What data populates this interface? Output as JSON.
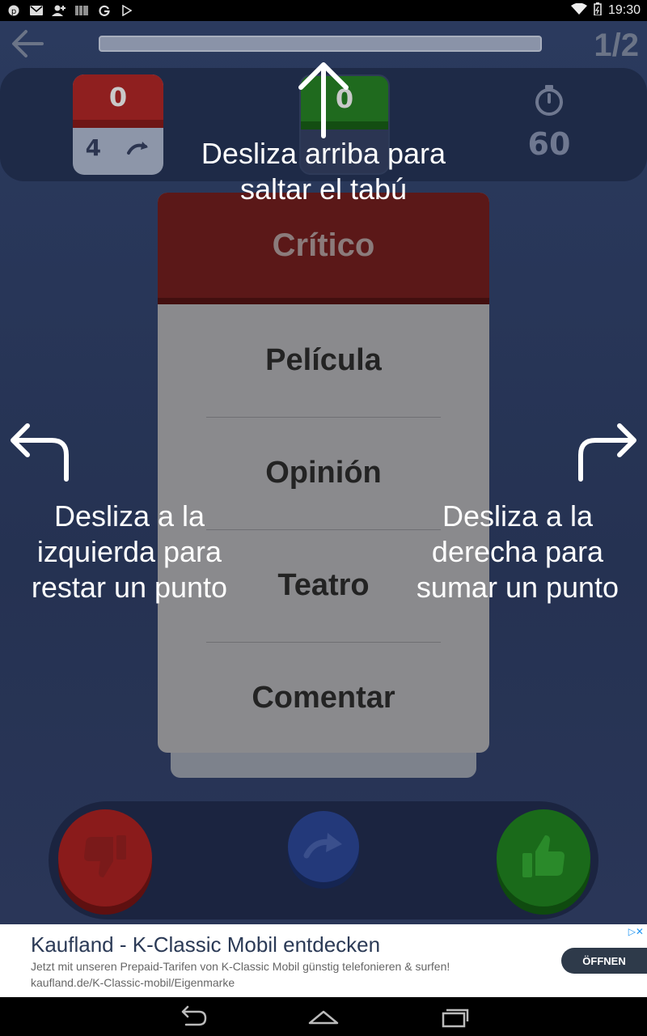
{
  "status_bar": {
    "left_icons": [
      "pinterest-icon",
      "mail-icon",
      "add-person-icon",
      "barcode-icon",
      "google-icon",
      "play-store-icon"
    ],
    "time": "19:30"
  },
  "header": {
    "round": "1/2"
  },
  "scores": {
    "red": {
      "score": "0",
      "skips": "4"
    },
    "green": {
      "score": "0"
    },
    "timer": "60"
  },
  "card": {
    "title": "Crítico",
    "words": [
      "Película",
      "Opinión",
      "Teatro",
      "Comentar"
    ]
  },
  "hints": {
    "up": "Desliza arriba para saltar el tabú",
    "left": "Desliza a la izquierda para restar un punto",
    "right": "Desliza a la derecha para sumar un punto"
  },
  "ad": {
    "title": "Kaufland - K-Classic Mobil entdecken",
    "description": "Jetzt mit unseren Prepaid-Tarifen von K-Classic Mobil günstig telefonieren & surfen!  kaufland.de/K-Classic-mobil/Eigenmarke",
    "button": "ÖFFNEN"
  },
  "colors": {
    "red": "#8f1f1f",
    "green": "#1f6a1e",
    "blue": "#23397a",
    "background": "#253252"
  }
}
